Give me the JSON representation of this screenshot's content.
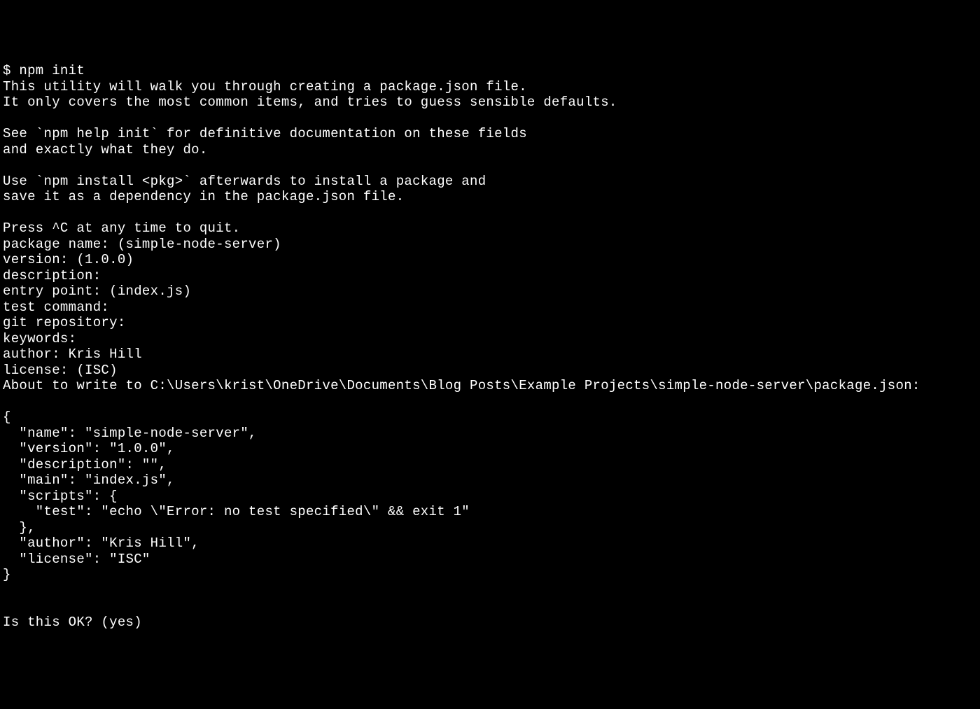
{
  "terminal": {
    "prompt": "$ ",
    "command": "npm init",
    "intro_line1": "This utility will walk you through creating a package.json file.",
    "intro_line2": "It only covers the most common items, and tries to guess sensible defaults.",
    "help_line1": "See `npm help init` for definitive documentation on these fields",
    "help_line2": "and exactly what they do.",
    "install_line1": "Use `npm install <pkg>` afterwards to install a package and",
    "install_line2": "save it as a dependency in the package.json file.",
    "quit_line": "Press ^C at any time to quit.",
    "prompts": {
      "package_name": "package name: (simple-node-server)",
      "version": "version: (1.0.0)",
      "description": "description:",
      "entry_point": "entry point: (index.js)",
      "test_command": "test command:",
      "git_repository": "git repository:",
      "keywords": "keywords:",
      "author": "author: Kris Hill",
      "license": "license: (ISC)"
    },
    "about_to_write": "About to write to C:\\Users\\krist\\OneDrive\\Documents\\Blog Posts\\Example Projects\\simple-node-server\\package.json:",
    "json_output": {
      "open_brace": "{",
      "name": "  \"name\": \"simple-node-server\",",
      "version": "  \"version\": \"1.0.0\",",
      "description": "  \"description\": \"\",",
      "main": "  \"main\": \"index.js\",",
      "scripts_open": "  \"scripts\": {",
      "test": "    \"test\": \"echo \\\"Error: no test specified\\\" && exit 1\"",
      "scripts_close": "  },",
      "author": "  \"author\": \"Kris Hill\",",
      "license": "  \"license\": \"ISC\"",
      "close_brace": "}"
    },
    "confirm": "Is this OK? (yes)"
  }
}
